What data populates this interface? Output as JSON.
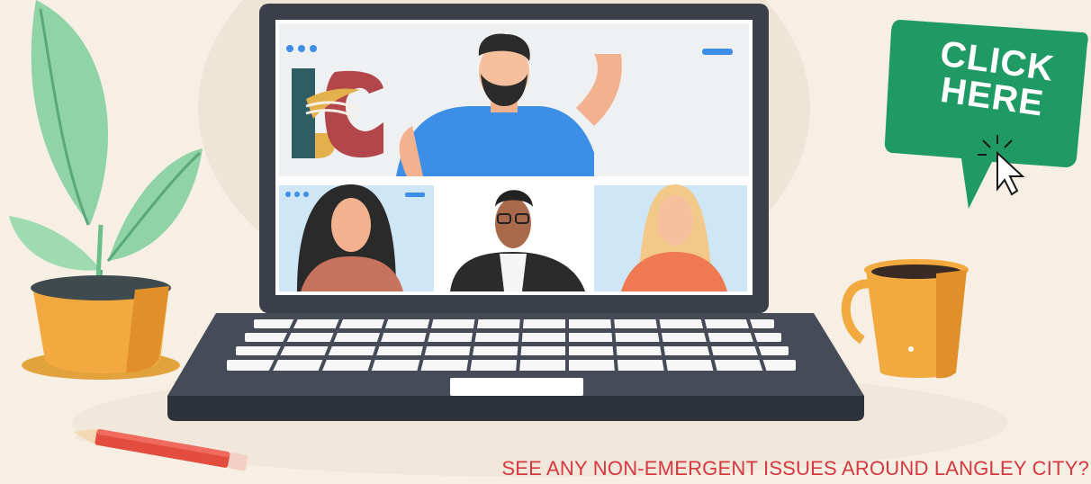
{
  "cta": {
    "line1": "CLICK",
    "line2": "HERE"
  },
  "footer": {
    "text": "SEE ANY NON-EMERGENT ISSUES AROUND LANGLEY CITY?"
  },
  "logo": {
    "letters": "LC"
  },
  "colors": {
    "background": "#f7efe4",
    "cta_green": "#1f9a64",
    "footer_red": "#d6383f",
    "laptop_dark": "#3a3f4a",
    "screen": "#eef0f2",
    "logo_teal": "#2e5d66",
    "logo_gold": "#e2b14b",
    "logo_maroon": "#b3464a"
  },
  "icons": [
    "plant-icon",
    "coffee-mug-icon",
    "pencil-icon",
    "laptop-icon",
    "cursor-icon",
    "logo"
  ]
}
